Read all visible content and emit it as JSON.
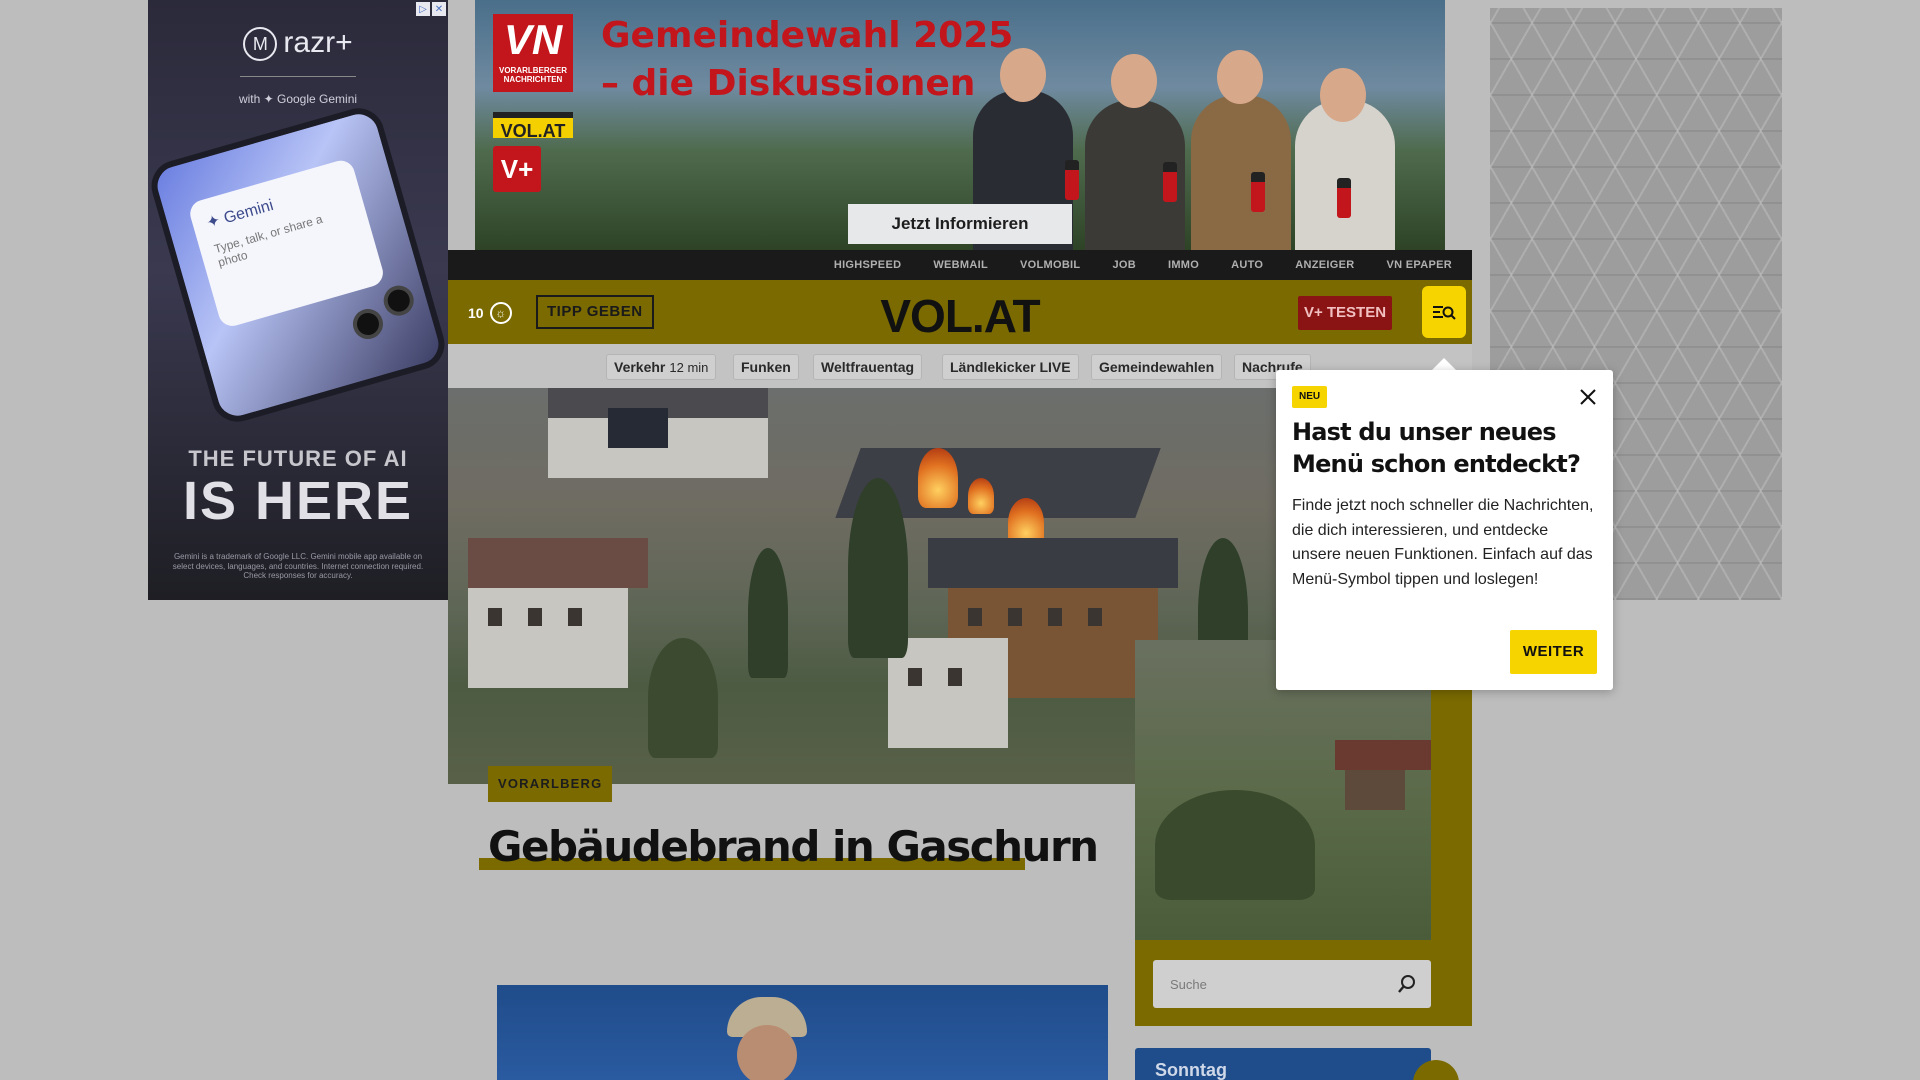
{
  "ads": {
    "left": {
      "adchoice_info": "▷",
      "adchoice_close": "✕",
      "brand_mark": "M",
      "brand": "razr+",
      "with_text": "with ✦ Google Gemini",
      "gemini_title": "✦ Gemini",
      "gemini_prompt": "Type, talk, or share a photo",
      "tagline_small": "THE FUTURE OF AI",
      "tagline_big": "IS HERE",
      "fine_print": "Gemini is a trademark of Google LLC. Gemini mobile app available on select devices, languages, and countries. Internet connection required. Check responses for accuracy."
    },
    "top": {
      "logo_vn": "VN",
      "logo_vn_sub": "VORARLBERGER NACHRICHTEN",
      "logo_vol": "VOL.AT",
      "logo_vplus": "V+",
      "headline": "Gemeindewahl 2025 – die Diskussionen",
      "cta": "Jetzt Informieren"
    }
  },
  "top_links": [
    "HIGHSPEED",
    "WEBMAIL",
    "VOLMOBIL",
    "JOB",
    "IMMO",
    "AUTO",
    "ANZEIGER",
    "VN EPAPER"
  ],
  "header": {
    "temperature": "10",
    "weather_icon": "cloud-sun",
    "tipp_label": "TIPP GEBEN",
    "logo": "VOL.AT",
    "vplus_label": "V+ TESTEN",
    "menu_icon": "menu-search"
  },
  "topics": [
    {
      "label": "Verkehr",
      "extra": "12 min"
    },
    {
      "label": "Funken",
      "extra": ""
    },
    {
      "label": "Weltfrauentag",
      "extra": ""
    },
    {
      "label": "Ländlekicker LIVE",
      "extra": ""
    },
    {
      "label": "Gemeindewahlen",
      "extra": ""
    },
    {
      "label": "Nachrufe",
      "extra": ""
    }
  ],
  "article": {
    "category": "VORARLBERG",
    "title": "Gebäudebrand in Gaschurn"
  },
  "sidebar": {
    "search_placeholder": "Suche",
    "next_card_label": "Sonntag"
  },
  "popup": {
    "badge": "NEU",
    "title": "Hast du unser neues Menü schon entdeckt?",
    "body": "Finde jetzt noch schneller die Nachrichten, die dich interessieren, und entdecke unsere neuen Funktionen. Einfach auf das Menü-Symbol tippen und loslegen!",
    "button": "WEITER"
  },
  "colors": {
    "brand_yellow": "#f5d400",
    "brand_red": "#c3161c",
    "dark_bar": "#1a1a1a",
    "overlay_dim": "#7a6a00"
  }
}
